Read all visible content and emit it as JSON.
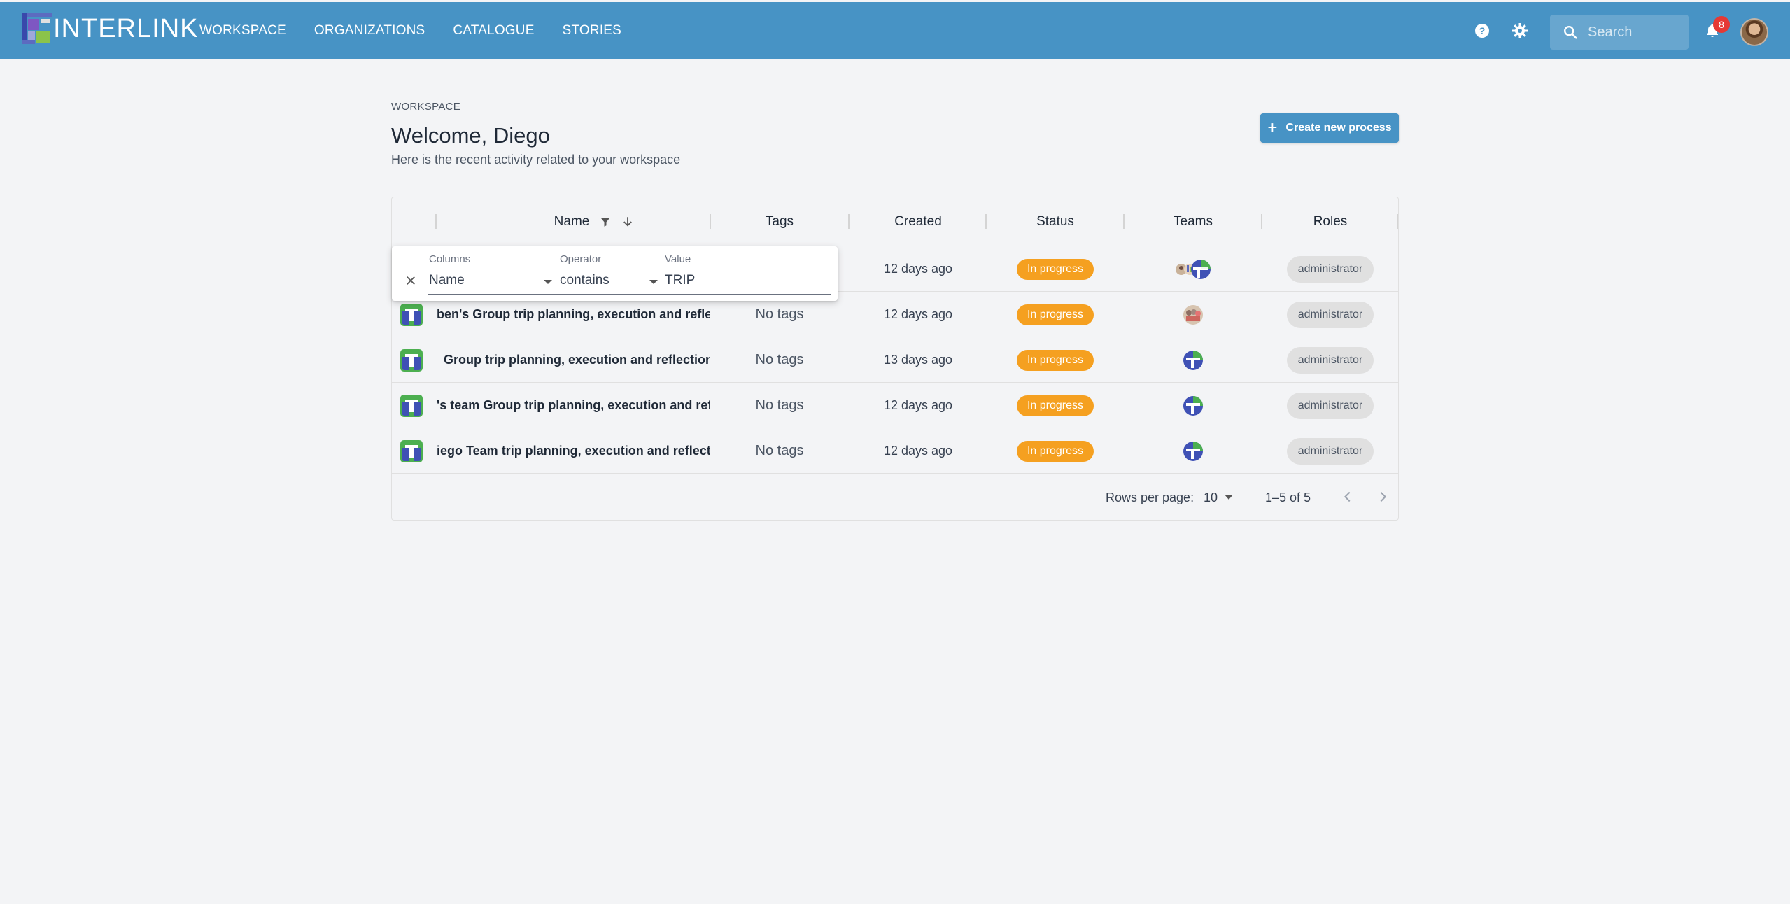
{
  "app": {
    "logo_text": "INTERLINK",
    "nav": [
      "WORKSPACE",
      "ORGANIZATIONS",
      "CATALOGUE",
      "STORIES"
    ],
    "search_placeholder": "Search",
    "notifications_count": "8",
    "brand_color": "#4793c5"
  },
  "page": {
    "breadcrumb": "WORKSPACE",
    "title": "Welcome, Diego",
    "subtitle": "Here is the recent activity related to your workspace",
    "create_button": "Create new process"
  },
  "table": {
    "columns": [
      "Name",
      "Tags",
      "Created",
      "Status",
      "Teams",
      "Roles"
    ],
    "rows": [
      {
        "name": "",
        "tags": "",
        "created": "12 days ago",
        "status": "In progress",
        "role": "administrator"
      },
      {
        "name": "ben's Group trip planning, execution and reflect",
        "tags": "No tags",
        "created": "12 days ago",
        "status": "In progress",
        "role": "administrator"
      },
      {
        "name": "Group trip planning, execution and reflection",
        "tags": "No tags",
        "created": "13 days ago",
        "status": "In progress",
        "role": "administrator"
      },
      {
        "name": "'s team Group trip planning, execution and refle",
        "tags": "No tags",
        "created": "12 days ago",
        "status": "In progress",
        "role": "administrator"
      },
      {
        "name": "iego Team trip planning, execution and reflectic",
        "tags": "No tags",
        "created": "12 days ago",
        "status": "In progress",
        "role": "administrator"
      }
    ],
    "footer": {
      "rows_per_page_label": "Rows per page:",
      "rows_per_page_value": "10",
      "range": "1–5 of 5"
    }
  },
  "filter": {
    "columns_label": "Columns",
    "columns_value": "Name",
    "operator_label": "Operator",
    "operator_value": "contains",
    "value_label": "Value",
    "value_value": "TRIP"
  },
  "colors": {
    "status_in_progress": "#f5a020",
    "role_chip": "#e0e0e0"
  }
}
